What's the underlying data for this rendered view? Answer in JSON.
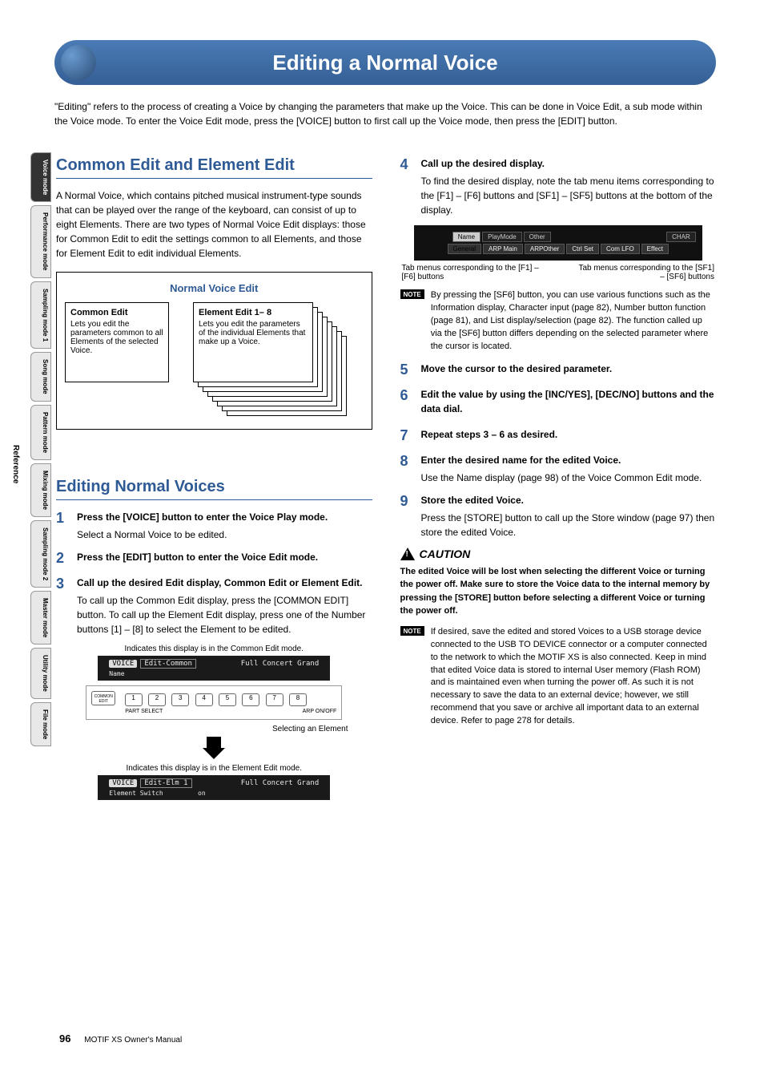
{
  "sidebar": {
    "reference_label": "Reference",
    "tabs": [
      {
        "label": "Voice mode",
        "active": true
      },
      {
        "label": "Performance mode"
      },
      {
        "label": "Sampling mode 1"
      },
      {
        "label": "Song mode"
      },
      {
        "label": "Pattern mode"
      },
      {
        "label": "Mixing mode"
      },
      {
        "label": "Sampling mode 2"
      },
      {
        "label": "Master mode"
      },
      {
        "label": "Utility mode"
      },
      {
        "label": "File mode"
      }
    ]
  },
  "title": "Editing a Normal Voice",
  "intro": "\"Editing\" refers to the process of creating a Voice by changing the parameters that make up the Voice. This can be done in Voice Edit, a sub mode within the Voice mode. To enter the Voice Edit mode, press the [VOICE] button to first call up the Voice mode, then press the [EDIT] button.",
  "left": {
    "h_common": "Common Edit and Element Edit",
    "common_text": "A Normal Voice, which contains pitched musical instrument-type sounds that can be played over the range of the keyboard, can consist of up to eight Elements. There are two types of Normal Voice Edit displays: those for Common Edit to edit the settings common to all Elements, and those for Element Edit to edit individual Elements.",
    "diagram": {
      "title": "Normal Voice Edit",
      "box1_title": "Common Edit",
      "box1_text": "Lets you edit the parameters common to all Elements of the selected Voice.",
      "box2_title": "Element Edit 1– 8",
      "box2_text": "Lets you edit the parameters of the individual Elements that make up a Voice."
    },
    "h_editing": "Editing Normal Voices",
    "steps": [
      {
        "n": "1",
        "t": "Press the [VOICE] button to enter the Voice Play mode.",
        "b": "Select a Normal Voice to be edited."
      },
      {
        "n": "2",
        "t": "Press the [EDIT] button to enter the Voice Edit mode.",
        "b": ""
      },
      {
        "n": "3",
        "t": "Call up the desired Edit display, Common Edit or Element Edit.",
        "b": "To call up the Common Edit display, press the [COMMON EDIT] button. To call up the Element Edit display, press one of the Number buttons [1] – [8] to select the Element to be edited."
      }
    ],
    "screens": {
      "cap1": "Indicates this display is in the Common Edit mode.",
      "lcd1_left": "VOICE",
      "lcd1_mid": "Edit-Common",
      "lcd1_right": "Full Concert Grand",
      "lcd1_row2": "Name",
      "btn_common": "COMMON EDIT",
      "btn_nums": [
        "1",
        "2",
        "3",
        "4",
        "5",
        "6",
        "7",
        "8"
      ],
      "btn_lab1": "PART SELECT",
      "btn_lab2": "ARP ON/OFF",
      "sel_elem": "Selecting an Element",
      "cap2": "Indicates this display is in the Element Edit mode.",
      "lcd2_left": "VOICE",
      "lcd2_mid": "Edit-Elm 1",
      "lcd2_right": "Full Concert Grand",
      "lcd2_row2a": "Element Switch",
      "lcd2_row2b": "on"
    }
  },
  "right": {
    "steps_a": [
      {
        "n": "4",
        "t": "Call up the desired display.",
        "b": "To find the desired display, note the tab menu items corresponding to the [F1] – [F6] buttons and [SF1] – [SF5] buttons at the bottom of the display."
      }
    ],
    "lcd_tabs_top": [
      "Name",
      "PlayMode",
      "Other"
    ],
    "lcd_tabs_top_right": "CHAR",
    "lcd_tabs_bot": [
      "General",
      "ARP Main",
      "ARPOther",
      "Ctrl Set",
      "Com LFO",
      "Effect"
    ],
    "lcd_note_left": "Tab menus corresponding to the [F1] – [F6] buttons",
    "lcd_note_right": "Tab menus corresponding to the [SF1] – [SF6] buttons",
    "note1_badge": "NOTE",
    "note1": "By pressing the [SF6] button, you can use various functions such as the Information display, Character input (page 82), Number button function (page 81), and List display/selection (page 82). The function called up via the [SF6] button differs depending on the selected parameter where the cursor is located.",
    "steps_b": [
      {
        "n": "5",
        "t": "Move the cursor to the desired parameter.",
        "b": ""
      },
      {
        "n": "6",
        "t": "Edit the value by using the [INC/YES], [DEC/NO] buttons and the data dial.",
        "b": ""
      },
      {
        "n": "7",
        "t": "Repeat steps 3 – 6 as desired.",
        "b": ""
      },
      {
        "n": "8",
        "t": "Enter the desired name for the edited Voice.",
        "b": "Use the Name display (page 98) of the Voice Common Edit mode."
      },
      {
        "n": "9",
        "t": "Store the edited Voice.",
        "b": "Press the [STORE] button to call up the Store window (page 97) then store the edited Voice."
      }
    ],
    "caution_label": "CAUTION",
    "caution_text": "The edited Voice will be lost when selecting the different Voice or turning the power off. Make sure to store the Voice data to the internal memory by pressing the [STORE] button before selecting a different Voice or turning the power off.",
    "note2_badge": "NOTE",
    "note2": "If desired, save the edited and stored Voices to a USB storage device connected to the USB TO DEVICE connector or a computer connected to the network to which the MOTIF XS is also connected. Keep in mind that edited Voice data is stored to internal User memory (Flash ROM) and is maintained even when turning the power off. As such it is not necessary to save the data to an external device; however, we still recommend that you save or archive all important data to an external device. Refer to page 278 for details."
  },
  "footer": {
    "page": "96",
    "manual": "MOTIF XS Owner's Manual"
  }
}
